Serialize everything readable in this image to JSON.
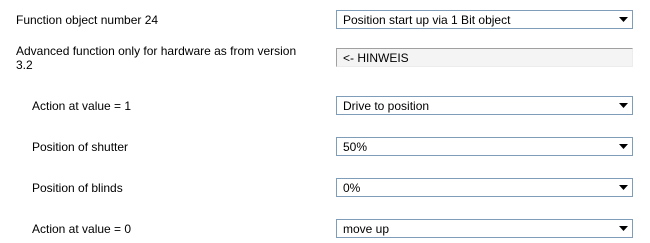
{
  "colors": {
    "background": "#ffffff",
    "text": "#000000",
    "select_border": "#7f9db9",
    "info_background": "#f4f4f4"
  },
  "rows": [
    {
      "label": "Function object number 24",
      "value": "Position start up via 1 Bit object",
      "control": "dropdown",
      "icon": "chevron-down-icon"
    },
    {
      "label": "Advanced function only for hardware as from version 3.2",
      "value": "<- HINWEIS",
      "control": "read-only-text"
    },
    {
      "label": "Action at value = 1",
      "value": "Drive to position",
      "control": "dropdown",
      "icon": "chevron-down-icon"
    },
    {
      "label": "Position of shutter",
      "value": "50%",
      "control": "dropdown",
      "icon": "chevron-down-icon"
    },
    {
      "label": "Position of blinds",
      "value": "0%",
      "control": "dropdown",
      "icon": "chevron-down-icon"
    },
    {
      "label": "Action at value = 0",
      "value": "move up",
      "control": "dropdown",
      "icon": "chevron-down-icon"
    }
  ]
}
